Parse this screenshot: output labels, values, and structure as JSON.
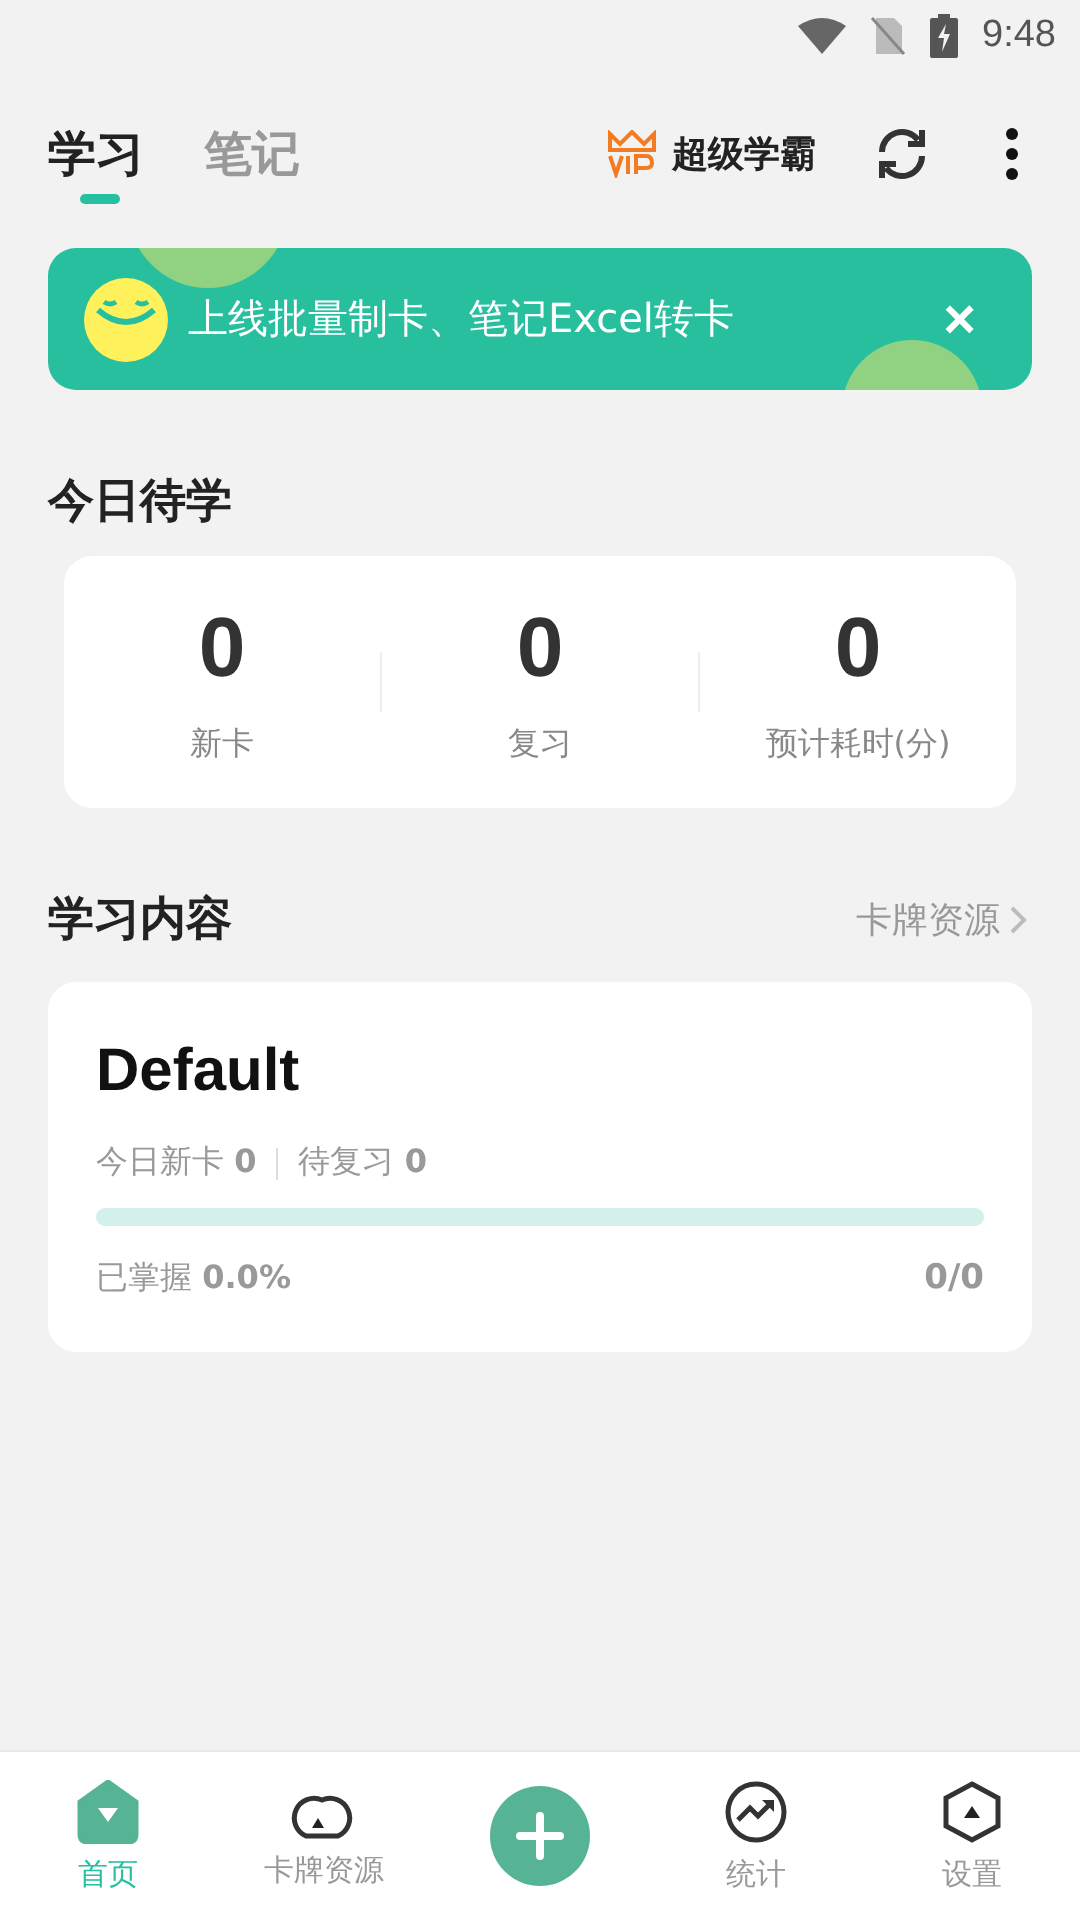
{
  "status_bar": {
    "time": "9:48"
  },
  "header": {
    "tabs": [
      {
        "label": "学习",
        "selected": true
      },
      {
        "label": "笔记",
        "selected": false
      }
    ],
    "vip_label": "超级学霸"
  },
  "banner": {
    "text": "上线批量制卡、笔记Excel转卡",
    "close": "×"
  },
  "today": {
    "title": "今日待学",
    "stats": [
      {
        "value": "0",
        "label": "新卡"
      },
      {
        "value": "0",
        "label": "复习"
      },
      {
        "value": "0",
        "label": "预计耗时(分)"
      }
    ]
  },
  "content": {
    "title": "学习内容",
    "link": "卡牌资源",
    "decks": [
      {
        "name": "Default",
        "new_today": "今日新卡 **0**",
        "to_review": "待复习 **0**",
        "level": 0,
        "mastered": "已掌握 **0.0%**",
        "count": "0/0"
      }
    ]
  },
  "nav": [
    {
      "kind": "home",
      "label": "首页",
      "selected": true
    },
    {
      "kind": "cloud",
      "label": "卡牌资源",
      "selected": false
    },
    {
      "kind": "add",
      "selected": false
    },
    {
      "kind": "stats",
      "label": "统计",
      "selected": false
    },
    {
      "kind": "settings",
      "label": "设置",
      "selected": false
    }
  ]
}
